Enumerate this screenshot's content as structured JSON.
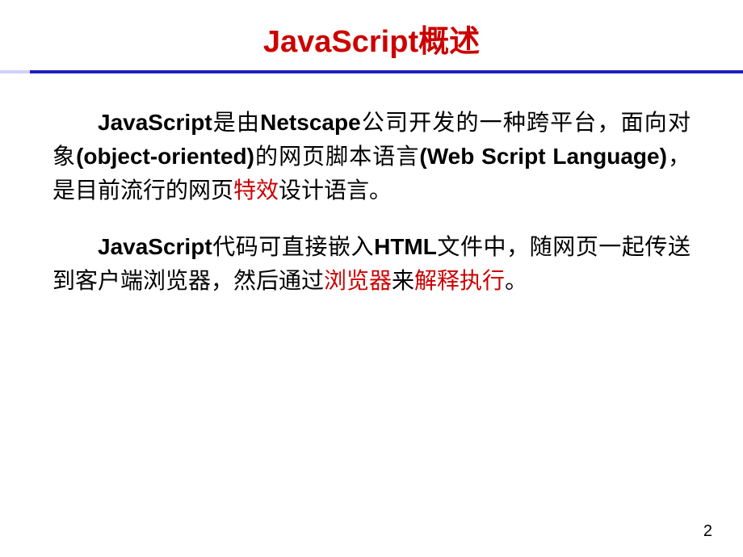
{
  "title": "JavaScript概述",
  "paragraph1": {
    "part1_bold": "JavaScript",
    "part2": "是由",
    "part3_bold": "Netscape",
    "part4": "公司开发的一种跨平台，面向对象",
    "part5_bold": "(object-oriented)",
    "part6": "的网页脚本语言",
    "part7_bold": "(Web Script Language)",
    "part8": "，是目前流行的网页",
    "part9_highlight": "特效",
    "part10": "设计语言。"
  },
  "paragraph2": {
    "part1_bold": "JavaScript",
    "part2": "代码可直接嵌入",
    "part3_bold": "HTML",
    "part4": "文件中，随网页一起传送到客户端浏览器，然后通过",
    "part5_highlight": "浏览器",
    "part6": "来",
    "part7_highlight": "解释执行",
    "part8": "。"
  },
  "pageNumber": "2"
}
